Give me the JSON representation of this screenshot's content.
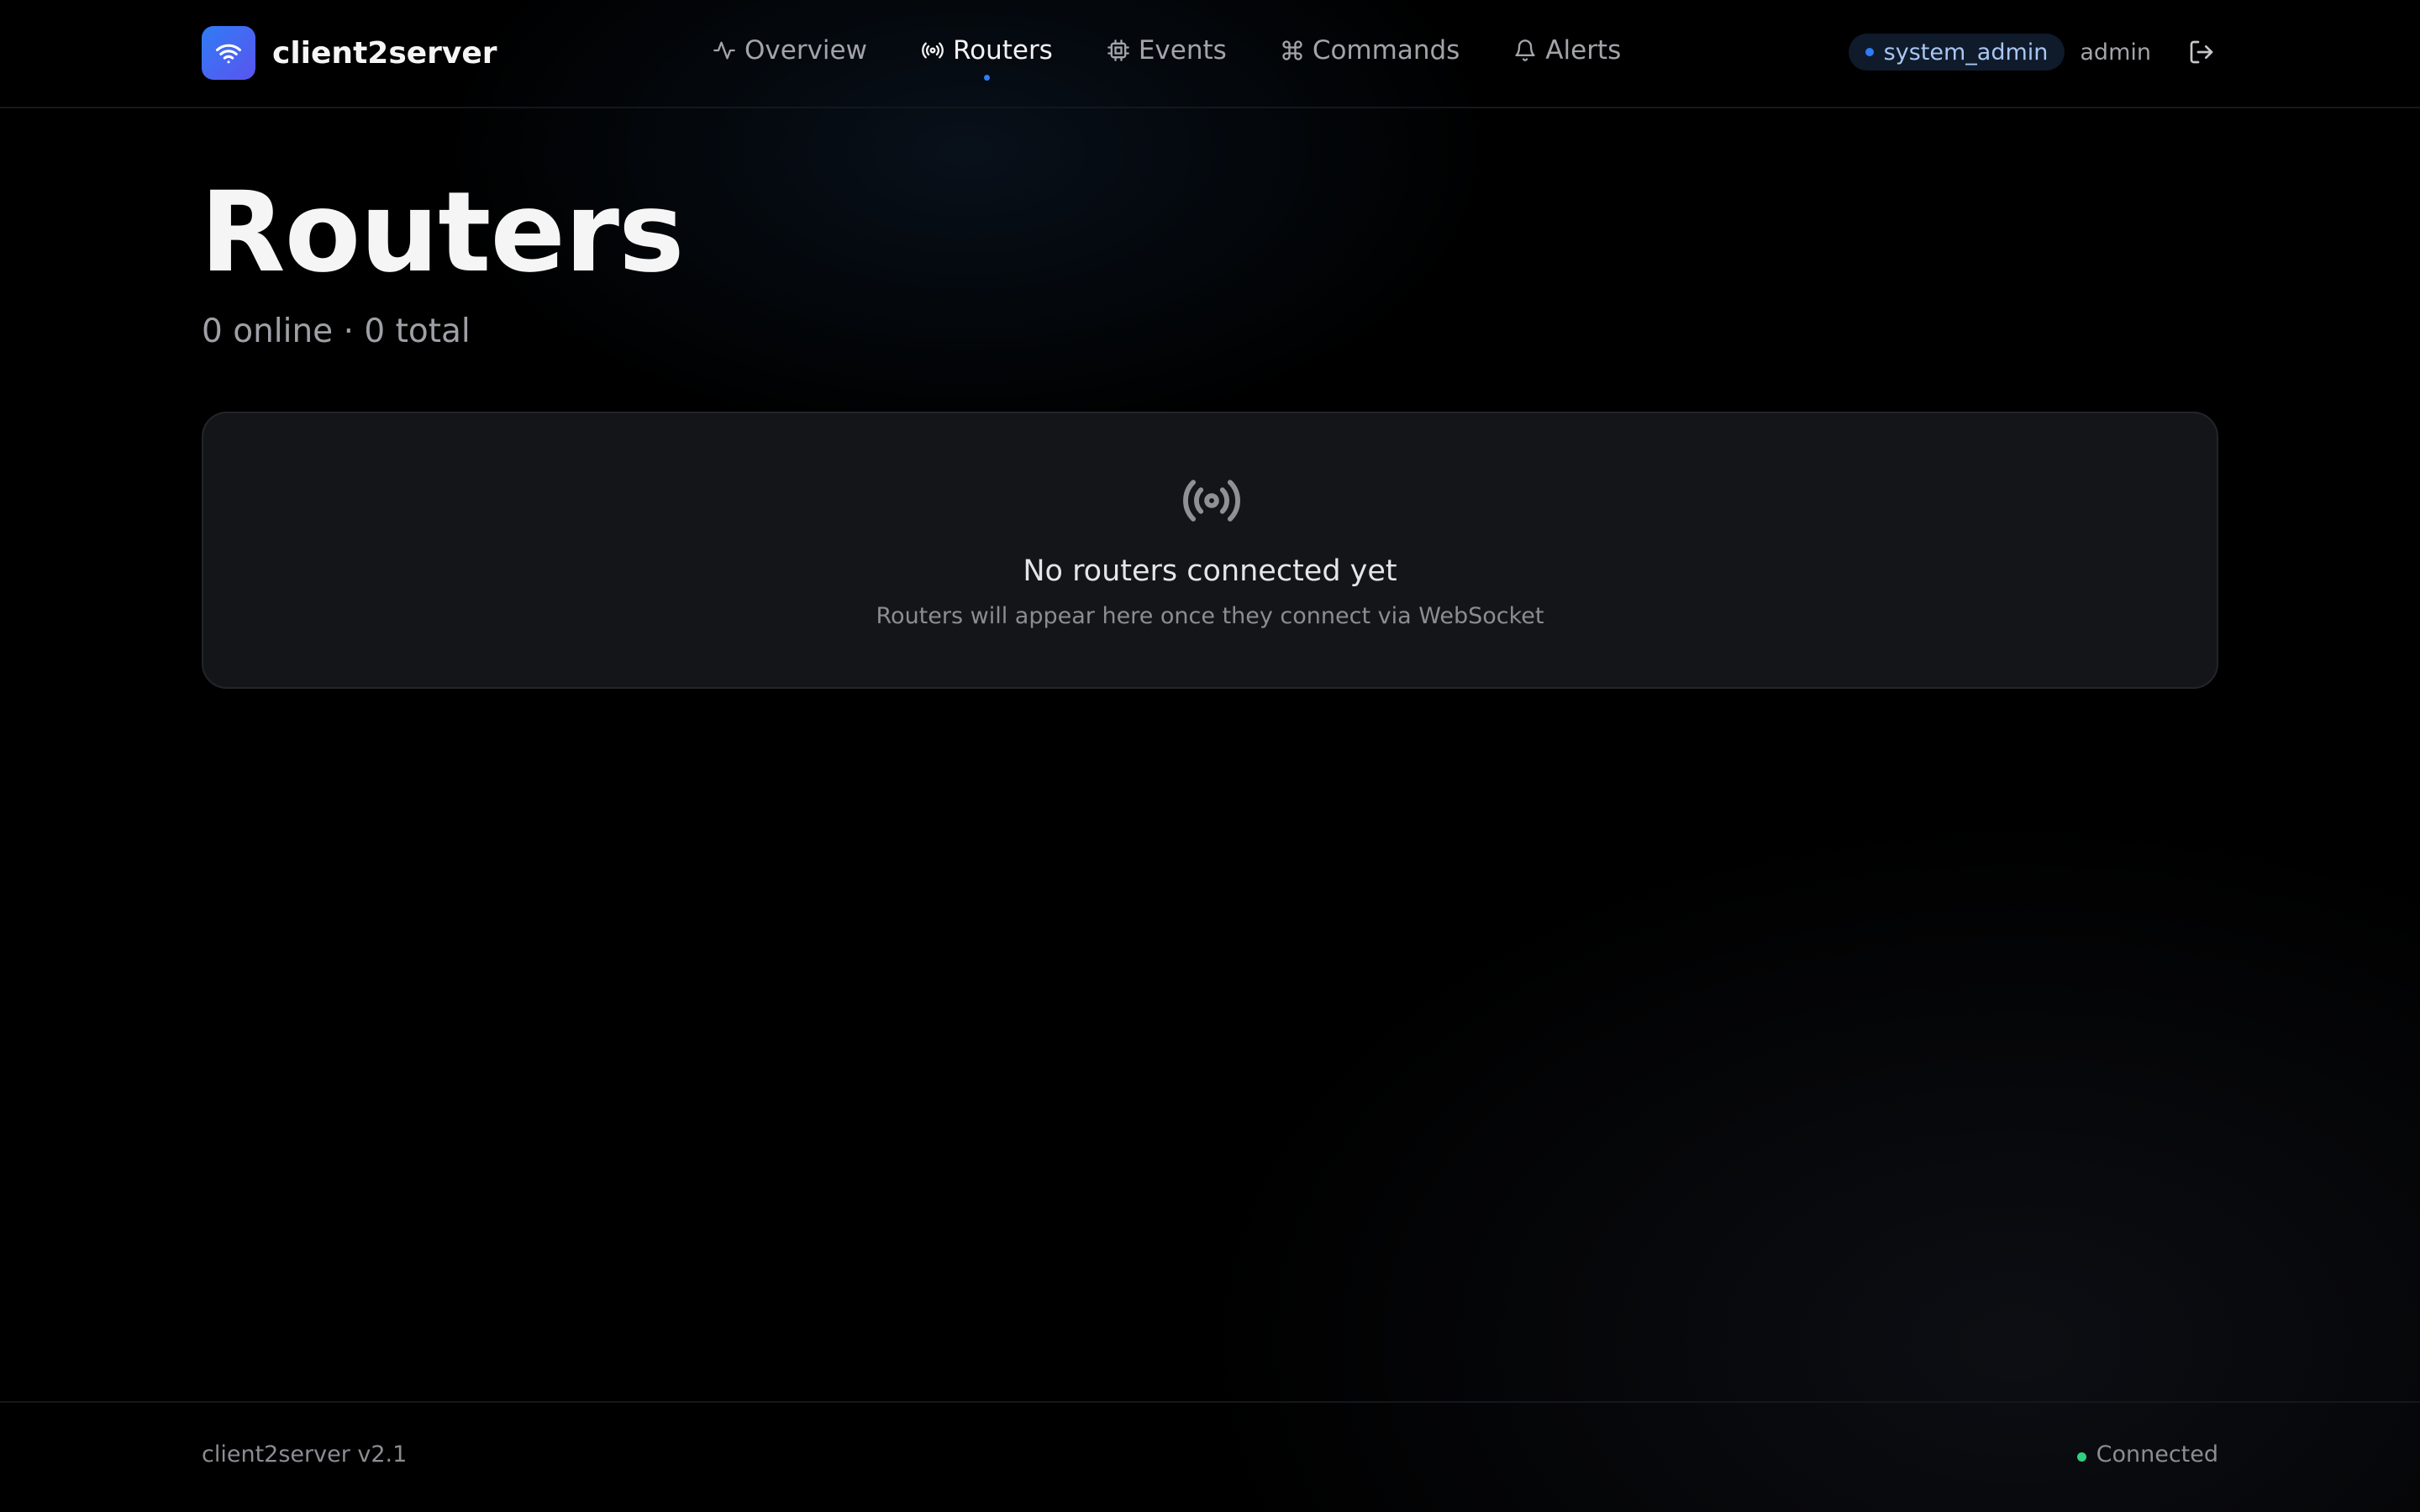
{
  "app": {
    "name": "client2server"
  },
  "nav": {
    "items": [
      {
        "label": "Overview",
        "icon": "activity-icon"
      },
      {
        "label": "Routers",
        "icon": "broadcast-icon"
      },
      {
        "label": "Events",
        "icon": "cpu-icon"
      },
      {
        "label": "Commands",
        "icon": "command-icon"
      },
      {
        "label": "Alerts",
        "icon": "bell-icon"
      }
    ],
    "active": "Routers"
  },
  "user": {
    "role": "system_admin",
    "name": "admin"
  },
  "page": {
    "title": "Routers",
    "subtitle": "0 online · 0 total"
  },
  "empty_state": {
    "icon": "broadcast-icon",
    "title": "No routers connected yet",
    "description": "Routers will appear here once they connect via WebSocket"
  },
  "footer": {
    "version": "client2server v2.1",
    "status": "Connected"
  },
  "colors": {
    "accent": "#2f7cf6",
    "status_ok": "#2fd07e",
    "background": "#000000"
  }
}
